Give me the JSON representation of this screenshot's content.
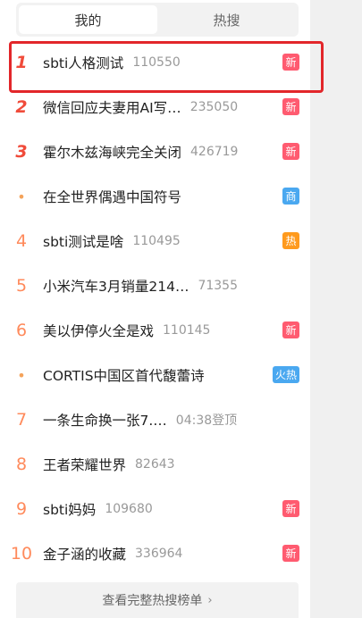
{
  "tabs": [
    {
      "label": "我的",
      "active": true
    },
    {
      "label": "热搜",
      "active": false
    }
  ],
  "items": [
    {
      "rank": "1",
      "title": "sbti人格测试",
      "count": "110550",
      "badge": "新",
      "badge_type": "new"
    },
    {
      "rank": "2",
      "title": "微信回应夫妻用AI写…",
      "count": "235050",
      "badge": "新",
      "badge_type": "new"
    },
    {
      "rank": "3",
      "title": "霍尔木兹海峡完全关闭",
      "count": "426719",
      "badge": "新",
      "badge_type": "new"
    },
    {
      "rank": "•",
      "title": "在全世界偶遇中国符号",
      "count": "",
      "badge": "商",
      "badge_type": "ad"
    },
    {
      "rank": "4",
      "title": "sbti测试是啥",
      "count": "110495",
      "badge": "热",
      "badge_type": "hot"
    },
    {
      "rank": "5",
      "title": "小米汽车3月销量214…",
      "count": "71355",
      "badge": "",
      "badge_type": ""
    },
    {
      "rank": "6",
      "title": "美以伊停火全是戏",
      "count": "110145",
      "badge": "新",
      "badge_type": "new"
    },
    {
      "rank": "•",
      "title": "CORTIS中国区首代馥蕾诗",
      "count": "",
      "badge": "火热",
      "badge_type": "fire"
    },
    {
      "rank": "7",
      "title": "一条生命换一张7.…",
      "count": "04:38登顶",
      "badge": "",
      "badge_type": ""
    },
    {
      "rank": "8",
      "title": "王者荣耀世界",
      "count": "82643",
      "badge": "",
      "badge_type": ""
    },
    {
      "rank": "9",
      "title": "sbti妈妈",
      "count": "109680",
      "badge": "新",
      "badge_type": "new"
    },
    {
      "rank": "10",
      "title": "金子涵的收藏",
      "count": "336964",
      "badge": "新",
      "badge_type": "new"
    }
  ],
  "footer": {
    "label": "查看完整热搜榜单",
    "chevron": "›"
  },
  "colors": {
    "top_rank": "#f04b3a",
    "rank": "#ff8a5b",
    "badge_new": "#ff5b70",
    "badge_ad": "#4aa8f0",
    "badge_hot": "#ff9a1d",
    "highlight": "#e2262a"
  }
}
